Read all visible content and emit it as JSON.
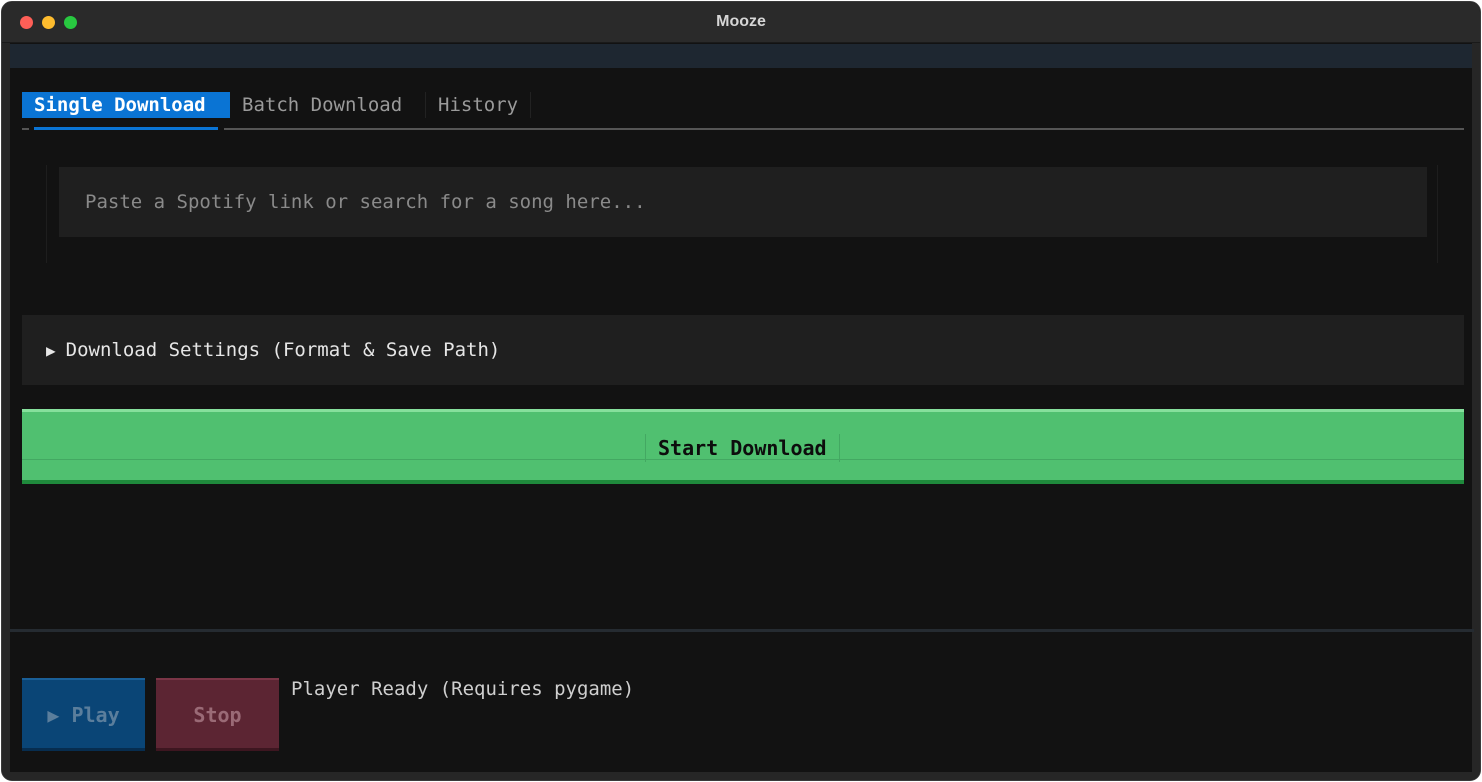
{
  "window": {
    "title": "Mooze"
  },
  "tabs": [
    {
      "label": "Single Download",
      "active": true
    },
    {
      "label": "Batch Download",
      "active": false
    },
    {
      "label": "History",
      "active": false
    }
  ],
  "search": {
    "placeholder": "Paste a Spotify link or search for a song here...",
    "value": ""
  },
  "settings": {
    "arrow": "▶",
    "label": "Download Settings (Format & Save Path)"
  },
  "start_button": {
    "label": "Start Download"
  },
  "player": {
    "play_label": "▶ Play",
    "stop_label": "Stop",
    "status": "Player Ready (Requires pygame)"
  },
  "colors": {
    "accent": "#0a74d4",
    "start_button": "#50c070",
    "play_button": "#0a4576",
    "stop_button": "#5c2533",
    "background": "#121212"
  }
}
